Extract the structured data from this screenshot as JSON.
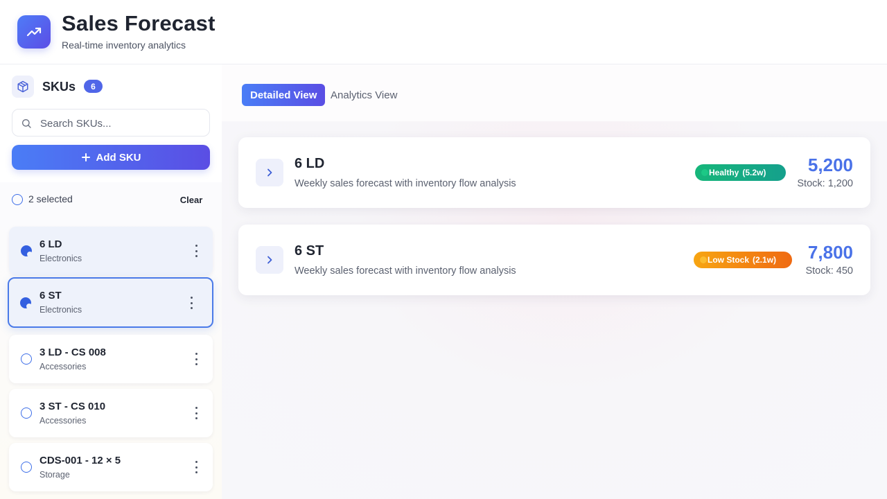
{
  "header": {
    "title": "Sales Forecast",
    "subtitle": "Real-time inventory analytics",
    "logo_icon": "trending-up-icon",
    "accent_gradient": [
      "#4f7cf7",
      "#5b4de6"
    ]
  },
  "sidebar": {
    "title": "SKUs",
    "count": "6",
    "search_placeholder": "Search SKUs...",
    "add_label": "Add SKU",
    "selection_text": "2 selected",
    "clear_label": "Clear",
    "items": [
      {
        "name": "6 LD",
        "category": "Electronics",
        "checked": true,
        "state": "selected"
      },
      {
        "name": "6 ST",
        "category": "Electronics",
        "checked": true,
        "state": "active"
      },
      {
        "name": "3 LD - CS 008",
        "category": "Accessories",
        "checked": false,
        "state": "normal"
      },
      {
        "name": "3 ST - CS 010",
        "category": "Accessories",
        "checked": false,
        "state": "normal"
      },
      {
        "name": "CDS-001 - 12 × 5",
        "category": "Storage",
        "checked": false,
        "state": "normal"
      }
    ]
  },
  "main": {
    "tabs": [
      {
        "label": "Detailed View",
        "active": true
      },
      {
        "label": "Analytics View",
        "active": false
      }
    ],
    "cards": [
      {
        "title": "6 LD",
        "description": "Weekly sales forecast with inventory flow analysis",
        "status_label": "Healthy",
        "status_weeks": "(5.2w)",
        "status_color": "#16b67a",
        "forecast": "5,200",
        "stock": "Stock: 1,200"
      },
      {
        "title": "6 ST",
        "description": "Weekly sales forecast with inventory flow analysis",
        "status_label": "Low Stock",
        "status_weeks": "(2.1w)",
        "status_color": "#f7a512",
        "forecast": "7,800",
        "stock": "Stock: 450"
      }
    ]
  }
}
